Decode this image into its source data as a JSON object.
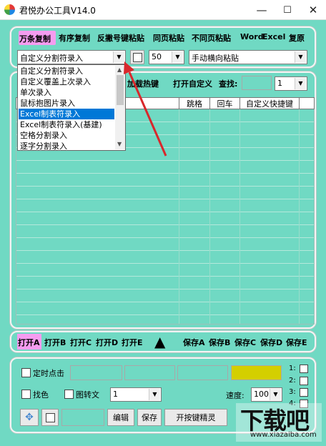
{
  "window": {
    "title": "君悦办公工具V14.0",
    "minimize": "—",
    "maximize": "☐",
    "close": "✕"
  },
  "toolbar": {
    "items": [
      "万条复制",
      "有序复制",
      "反撇号键粘贴",
      "同页粘贴",
      "不同页粘贴",
      "Word",
      "Excel",
      "复原"
    ],
    "active": "万条复制"
  },
  "row2": {
    "mode_select": "自定义分割符录入",
    "count_select": "50",
    "paste_mode_select": "手动横向粘贴"
  },
  "row3": {
    "load_hotkey": "加载热键",
    "open_custom": "打开自定义",
    "find_label": "查找:",
    "find_value": "",
    "page_select": "1"
  },
  "grid": {
    "headers": [
      "跳格",
      "回车",
      "自定义快捷键"
    ]
  },
  "dropdown": {
    "options": [
      "自定义分割符录入",
      "自定义覆盖上次录入",
      "单次录入",
      "鼠标抱图片录入",
      "Excel制表符录入",
      "Excel制表符录入(基建)",
      "空格分割录入",
      "逐字分割录入"
    ],
    "highlighted": "Excel制表符录入"
  },
  "bottombar": {
    "open": [
      "打开A",
      "打开B",
      "打开C",
      "打开D",
      "打开E"
    ],
    "save": [
      "保存A",
      "保存B",
      "保存C",
      "保存D",
      "保存E"
    ],
    "up_arrow": "▲"
  },
  "bottom": {
    "timer_click": "定时点击",
    "find_color": "找色",
    "image_to_text": "图转文",
    "combo_value": "1",
    "speed_label": "速度:",
    "speed_value": "100",
    "edit": "编辑",
    "save": "保存",
    "start_key_wizard": "开按键精灵",
    "side_labels": [
      "1:",
      "2:",
      "3:",
      "4:"
    ],
    "color_swatch": "#d4cf00"
  },
  "watermark": {
    "text": "下载吧",
    "url": "www.xiazaiba.com"
  },
  "colors": {
    "background": "#70d9c3",
    "highlight": "#0078d7",
    "active_toolbar": "#f59cf0"
  }
}
